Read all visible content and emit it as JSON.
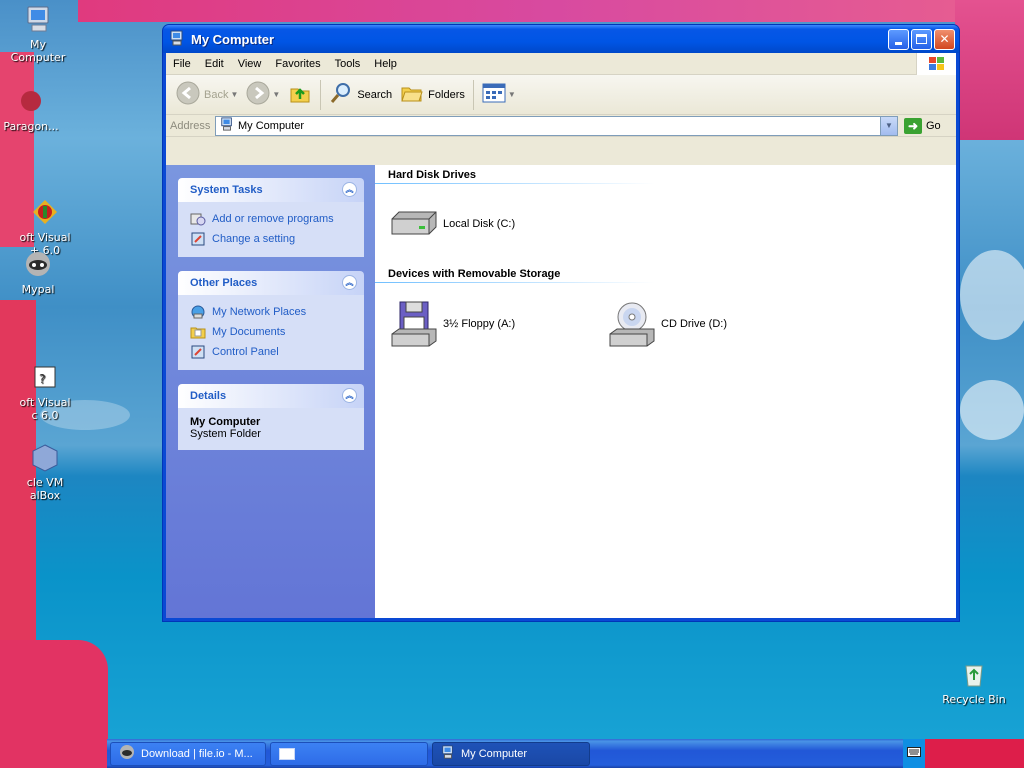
{
  "desktop": {
    "icons": [
      {
        "label": "My Computer"
      },
      {
        "label": "Paragon..."
      },
      {
        "label": "oft Visual\n+ 6.0"
      },
      {
        "label": "Mypal"
      },
      {
        "label": "oft Visual\nc 6.0"
      },
      {
        "label": "cle VM\nalBox"
      },
      {
        "label": "Recycle Bin"
      }
    ]
  },
  "window": {
    "title": "My Computer",
    "menu": [
      "File",
      "Edit",
      "View",
      "Favorites",
      "Tools",
      "Help"
    ],
    "toolbar": {
      "back_label": "Back",
      "search_label": "Search",
      "folders_label": "Folders"
    },
    "address": {
      "label": "Address",
      "value": "My Computer",
      "go_label": "Go"
    },
    "left_pane": {
      "system_tasks": {
        "title": "System Tasks",
        "items": [
          "Add or remove programs",
          "Change a setting"
        ]
      },
      "other_places": {
        "title": "Other Places",
        "items": [
          "My Network Places",
          "My Documents",
          "Control Panel"
        ]
      },
      "details": {
        "title": "Details",
        "name": "My Computer",
        "type": "System Folder"
      }
    },
    "groups": [
      {
        "title": "Hard Disk Drives",
        "items": [
          {
            "label": "Local Disk (C:)",
            "icon": "hard-disk-icon"
          }
        ]
      },
      {
        "title": "Devices with Removable Storage",
        "items": [
          {
            "label": "3½ Floppy (A:)",
            "icon": "floppy-drive-icon"
          },
          {
            "label": "CD Drive (D:)",
            "icon": "cd-drive-icon"
          }
        ]
      }
    ]
  },
  "taskbar": {
    "buttons": [
      {
        "label": "Download | file.io - M..."
      },
      {
        "label": ""
      },
      {
        "label": "My Computer"
      }
    ]
  },
  "colors": {
    "title_blue": "#0055e5",
    "task_link": "#215dc6",
    "left_pane": "#6f88da"
  }
}
